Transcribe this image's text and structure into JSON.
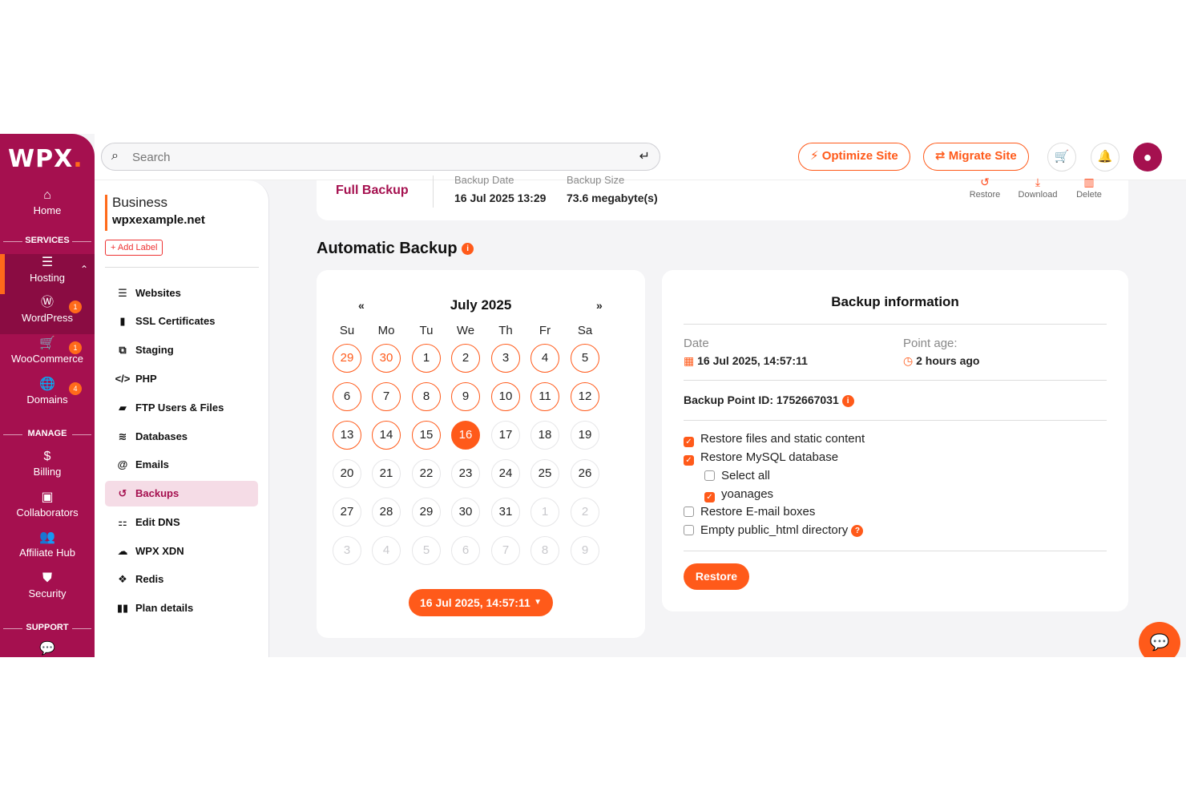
{
  "brand": {
    "logo": "WPX",
    "logo_dot": ".",
    "accent": "#a5104f",
    "orange": "#ff5a1a"
  },
  "rail": {
    "home": "Home",
    "services_label": "SERVICES",
    "hosting": "Hosting",
    "wordpress": "WordPress",
    "wordpress_badge": "1",
    "woocommerce": "WooCommerce",
    "woocommerce_badge": "1",
    "domains": "Domains",
    "domains_badge": "4",
    "manage_label": "MANAGE",
    "billing": "Billing",
    "collaborators": "Collaborators",
    "affiliate_hub": "Affiliate Hub",
    "security": "Security",
    "support_label": "SUPPORT"
  },
  "topbar": {
    "search_placeholder": "Search",
    "optimize": "Optimize Site",
    "migrate": "Migrate Site"
  },
  "account": {
    "plan": "Business",
    "domain": "wpxexample.net",
    "add_label": "+ Add Label"
  },
  "side_menu": [
    "Websites",
    "SSL Certificates",
    "Staging",
    "PHP",
    "FTP Users & Files",
    "Databases",
    "Emails",
    "Backups",
    "Edit DNS",
    "WPX XDN",
    "Redis",
    "Plan details"
  ],
  "full_backup": {
    "title": "Full Backup",
    "date_label": "Backup Date",
    "date_value": "16 Jul 2025  13:29",
    "size_label": "Backup Size",
    "size_value": "73.6 megabyte(s)",
    "restore": "Restore",
    "download": "Download",
    "delete": "Delete"
  },
  "automatic": {
    "title": "Automatic Backup",
    "info": "i"
  },
  "calendar": {
    "prev": "«",
    "next": "»",
    "month": "July 2025",
    "weekdays": [
      "Su",
      "Mo",
      "Tu",
      "We",
      "Th",
      "Fr",
      "Sa"
    ],
    "weeks": [
      [
        "29",
        "30",
        "1",
        "2",
        "3",
        "4",
        "5"
      ],
      [
        "6",
        "7",
        "8",
        "9",
        "10",
        "11",
        "12"
      ],
      [
        "13",
        "14",
        "15",
        "16",
        "17",
        "18",
        "19"
      ],
      [
        "20",
        "21",
        "22",
        "23",
        "24",
        "25",
        "26"
      ],
      [
        "27",
        "28",
        "29",
        "30",
        "31",
        "1",
        "2"
      ],
      [
        "3",
        "4",
        "5",
        "6",
        "7",
        "8",
        "9"
      ]
    ],
    "selected_button": "16 Jul 2025, 14:57:11"
  },
  "backup_info": {
    "title": "Backup information",
    "date_label": "Date",
    "date_value": "16 Jul 2025, 14:57:11",
    "age_label": "Point age:",
    "age_value": "2 hours ago",
    "point_id": "Backup Point ID: 1752667031",
    "options": [
      {
        "label": "Restore files and static content",
        "checked": true
      },
      {
        "label": "Restore MySQL database",
        "checked": true
      },
      {
        "label": "Select all",
        "checked": false
      },
      {
        "label": "yoanages",
        "checked": true
      },
      {
        "label": "Restore E-mail boxes",
        "checked": false
      },
      {
        "label": "Empty public_html directory",
        "checked": false
      }
    ],
    "restore_button": "Restore"
  }
}
